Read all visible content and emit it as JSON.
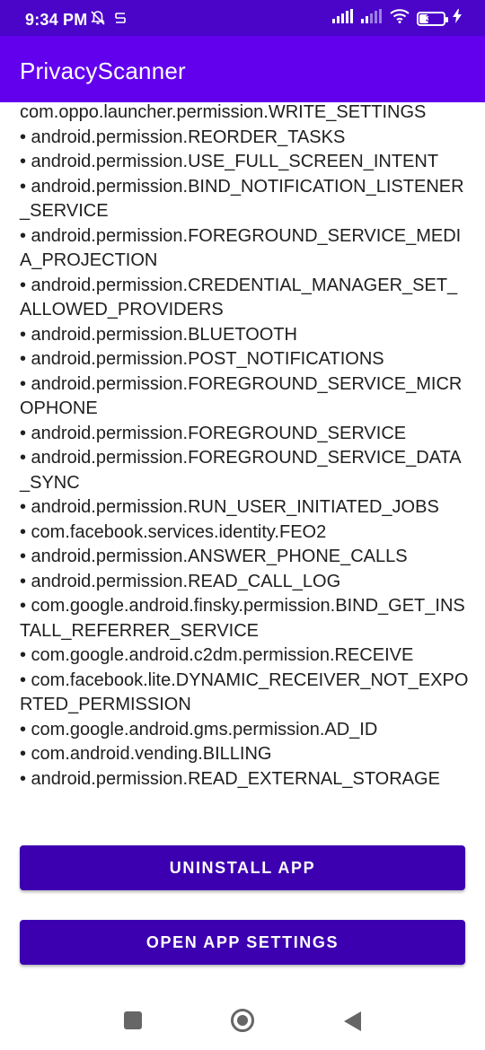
{
  "status_bar": {
    "time": "9:34 PM",
    "battery_level": "39",
    "icons": [
      "mute-icon",
      "data-saver-icon",
      "signal-icon",
      "signal-weak-icon",
      "wifi-icon",
      "battery-icon",
      "charging-icon"
    ]
  },
  "app_bar": {
    "title": "PrivacyScanner"
  },
  "permissions": [
    "com.oppo.launcher.permission.WRITE_SETTINGS",
    "• android.permission.REORDER_TASKS",
    "• android.permission.USE_FULL_SCREEN_INTENT",
    "• android.permission.BIND_NOTIFICATION_LISTENER_SERVICE",
    "• android.permission.FOREGROUND_SERVICE_MEDIA_PROJECTION",
    "• android.permission.CREDENTIAL_MANAGER_SET_ALLOWED_PROVIDERS",
    "• android.permission.BLUETOOTH",
    "• android.permission.POST_NOTIFICATIONS",
    "• android.permission.FOREGROUND_SERVICE_MICROPHONE",
    "• android.permission.FOREGROUND_SERVICE",
    "• android.permission.FOREGROUND_SERVICE_DATA_SYNC",
    "• android.permission.RUN_USER_INITIATED_JOBS",
    "• com.facebook.services.identity.FEO2",
    "• android.permission.ANSWER_PHONE_CALLS",
    "• android.permission.READ_CALL_LOG",
    "• com.google.android.finsky.permission.BIND_GET_INSTALL_REFERRER_SERVICE",
    "• com.google.android.c2dm.permission.RECEIVE",
    "• com.facebook.lite.DYNAMIC_RECEIVER_NOT_EXPORTED_PERMISSION",
    "• com.google.android.gms.permission.AD_ID",
    "• com.android.vending.BILLING",
    "• android.permission.READ_EXTERNAL_STORAGE"
  ],
  "buttons": {
    "uninstall": "UNINSTALL APP",
    "open_settings": "OPEN APP SETTINGS"
  },
  "nav_bar": {
    "icons": [
      "recents-icon",
      "home-icon",
      "back-icon"
    ]
  },
  "colors": {
    "status_bar": "#4a05c9",
    "app_bar": "#6200ee",
    "button": "#3c00b0"
  }
}
